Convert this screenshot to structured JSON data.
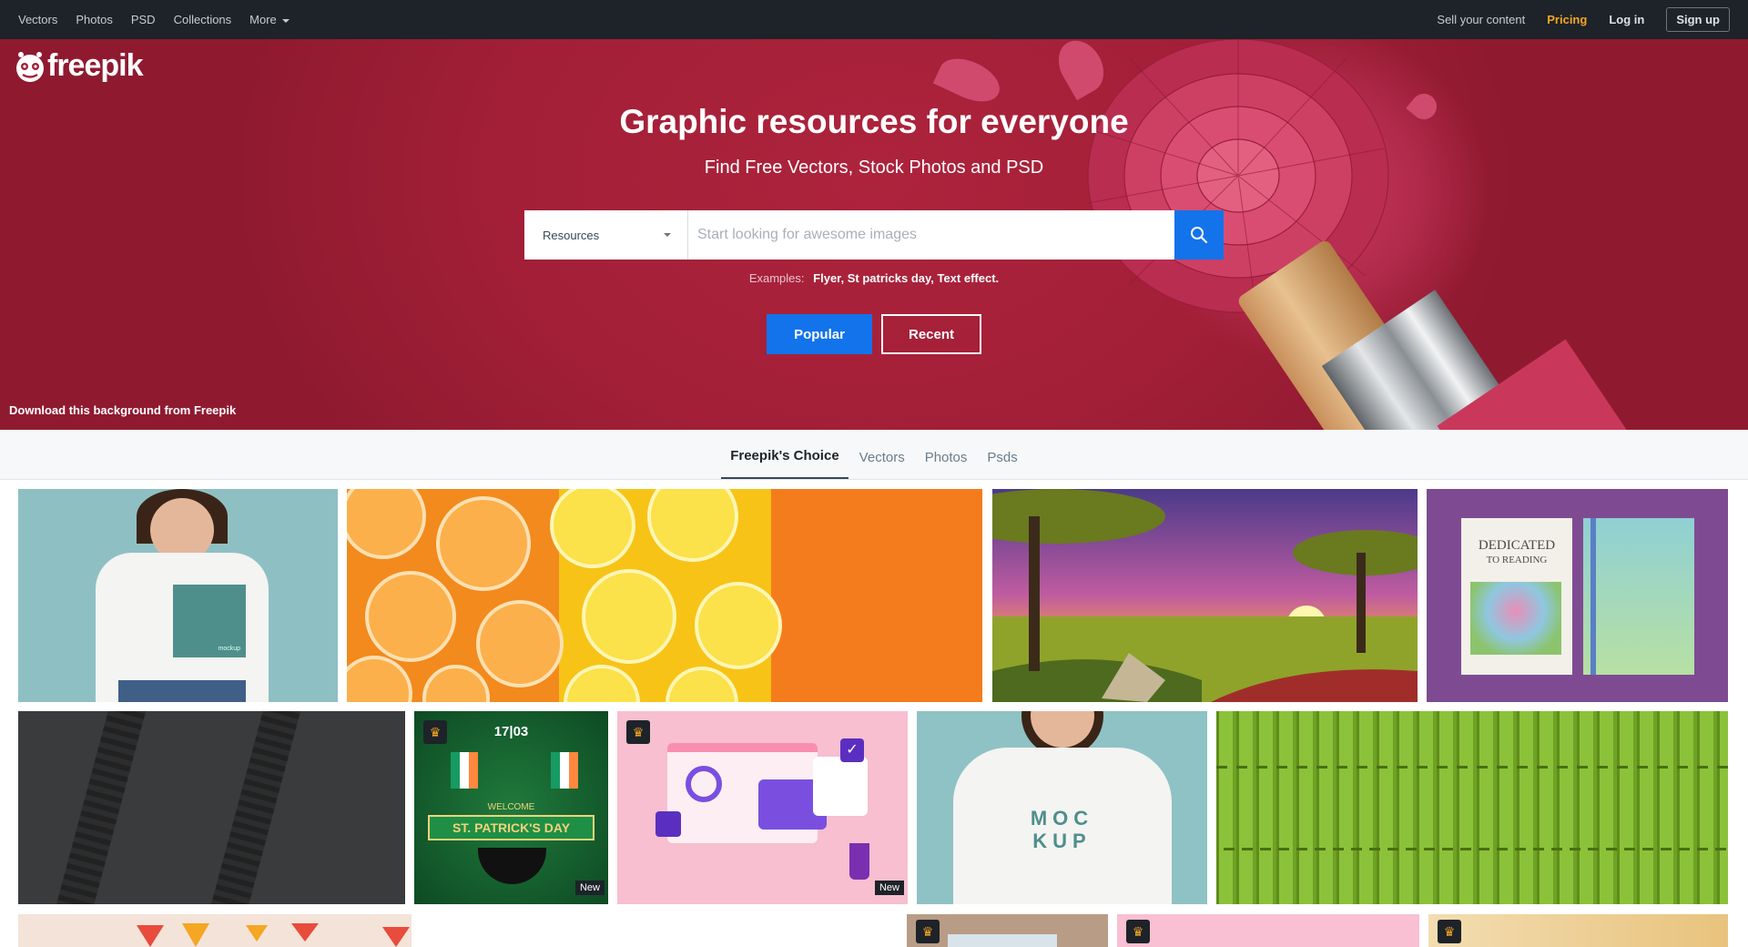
{
  "topnav": {
    "left": [
      "Vectors",
      "Photos",
      "PSD",
      "Collections"
    ],
    "more": "More",
    "sell": "Sell your content",
    "pricing": "Pricing",
    "login": "Log in",
    "signup": "Sign up"
  },
  "logo": {
    "text": "freepik"
  },
  "hero": {
    "title": "Graphic resources for everyone",
    "subtitle": "Find Free Vectors, Stock Photos and PSD",
    "resources_label": "Resources",
    "search_placeholder": "Start looking for awesome images",
    "examples_label": "Examples:",
    "examples_terms": "Flyer, St patricks day, Text effect.",
    "popular": "Popular",
    "recent": "Recent",
    "download_bg": "Download this background from Freepik"
  },
  "tabs": [
    "Freepik's Choice",
    "Vectors",
    "Photos",
    "Psds"
  ],
  "tiles": {
    "tshirt_label": "mockup",
    "book_title_line1": "DEDICATED",
    "book_title_line2": "TO READING",
    "stpatrick_date": "17|03",
    "stpatrick_welcome": "WELCOME",
    "stpatrick_title": "ST. PATRICK'S DAY",
    "mockup_text_line1": "MOC",
    "mockup_text_line2": "KUP",
    "badge_new": "New"
  },
  "colors": {
    "accent": "#1273eb",
    "pricing": "#f5a623",
    "hero_bg": "#a21f37",
    "nav_bg": "#1d2329"
  }
}
